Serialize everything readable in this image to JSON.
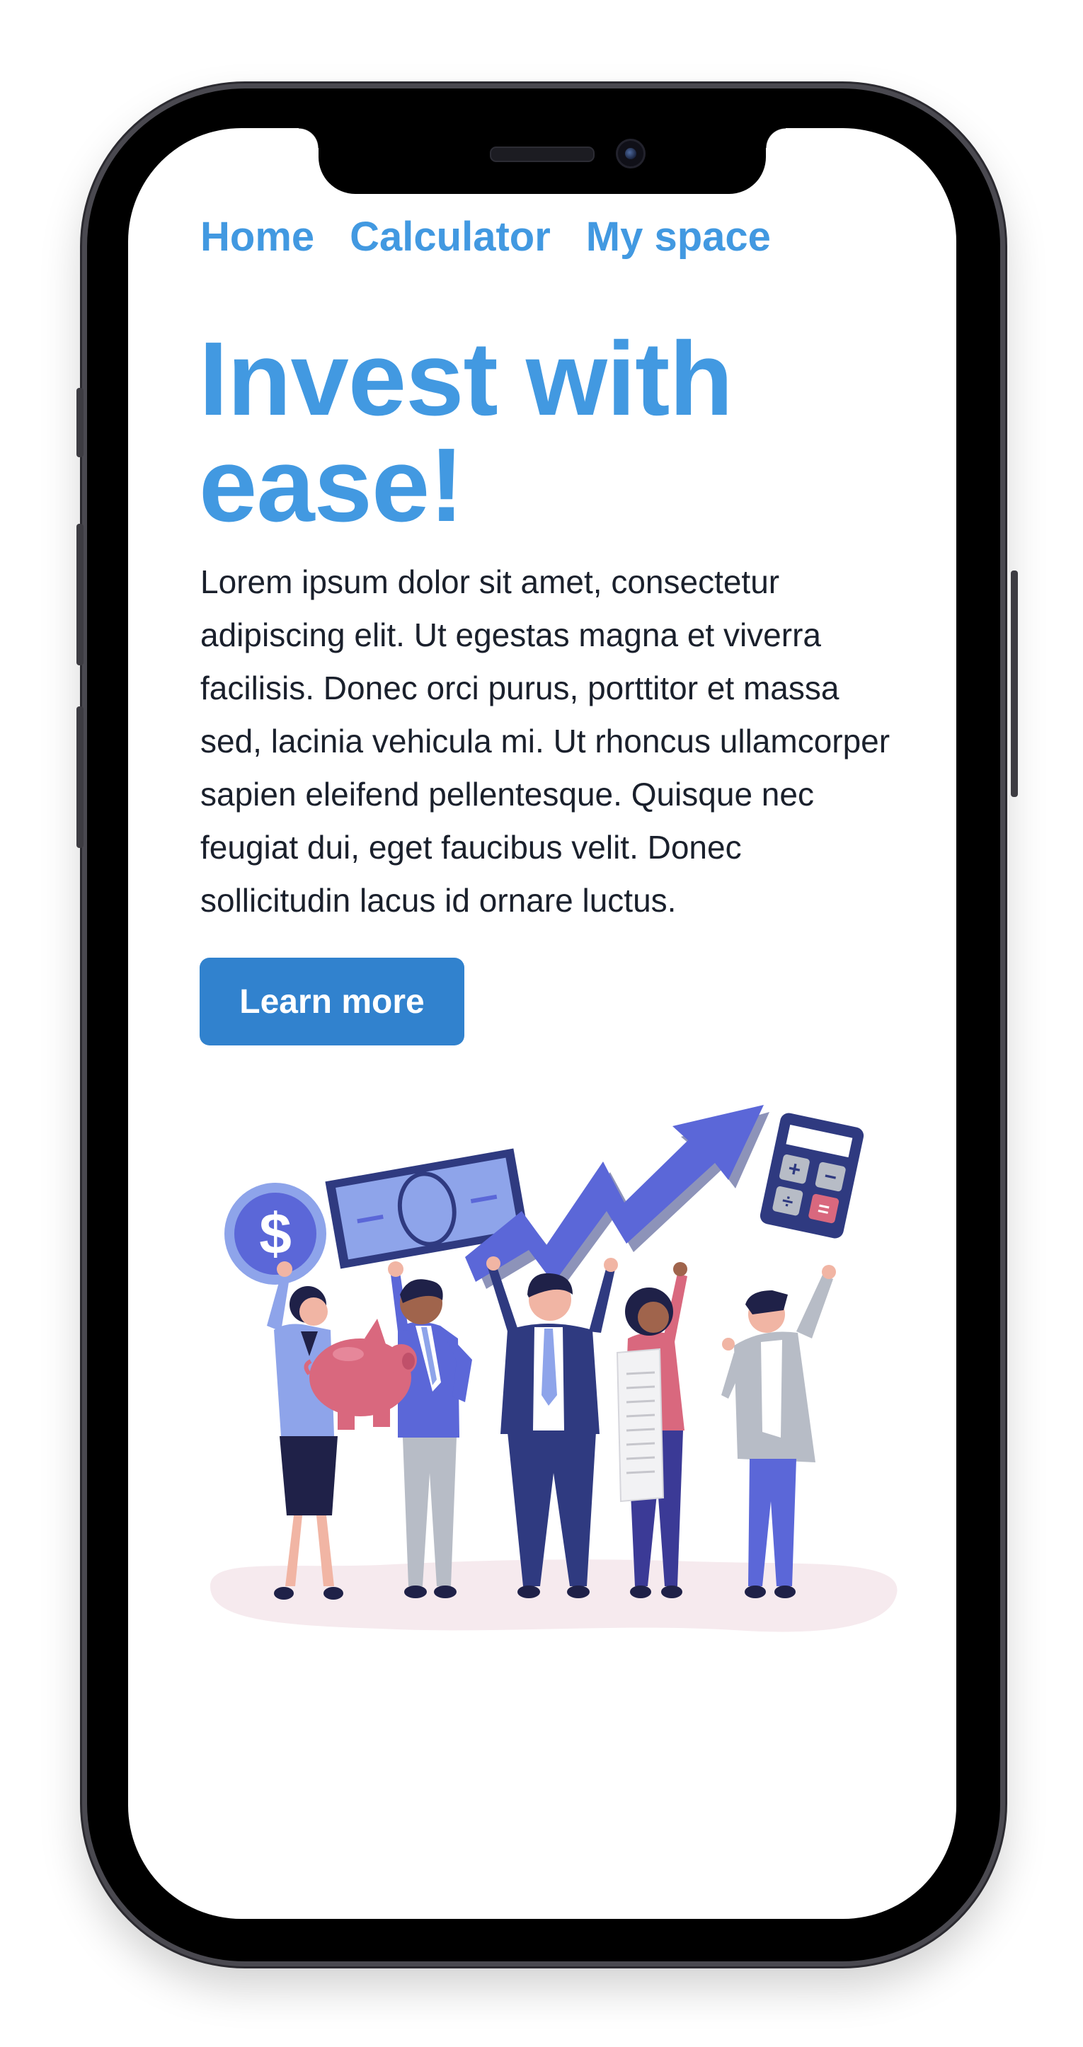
{
  "nav": {
    "items": [
      {
        "label": "Home"
      },
      {
        "label": "Calculator"
      },
      {
        "label": "My space"
      }
    ]
  },
  "hero": {
    "headline": "Invest with ease!",
    "body": "Lorem ipsum dolor sit amet, consectetur adipiscing elit. Ut egestas magna et viverra facilisis. Donec orci purus, porttitor et massa sed, lacinia vehicula mi. Ut rhoncus ullamcorper sapien eleifend pellentesque. Quisque nec feugiat dui, eget faucibus velit. Donec sollicitudin lacus id ornare luctus.",
    "cta_label": "Learn more",
    "illustration": {
      "coin_symbol": "$"
    }
  },
  "colors": {
    "accent": "#4299e1",
    "button": "#3182ce",
    "text": "#1a202c",
    "illustration_indigo": "#5b67d8",
    "illustration_navy": "#2f3a80",
    "illustration_pink": "#d9687e"
  }
}
